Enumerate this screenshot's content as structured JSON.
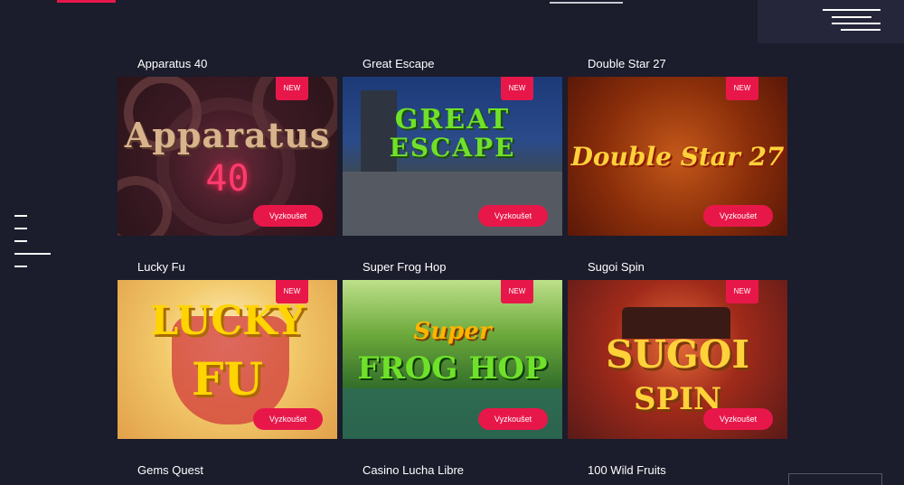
{
  "header": {
    "menu_icon": "hamburger-menu-icon",
    "side_menu_icon": "side-nav-menu-icon",
    "accent_color": "#e8174a"
  },
  "games": [
    {
      "title": "Apparatus 40",
      "badge": "NEW",
      "cta": "Vyzkoušet",
      "logo": "Apparatus",
      "sub": "40"
    },
    {
      "title": "Great Escape",
      "badge": "NEW",
      "cta": "Vyzkoušet",
      "logo": "GREAT",
      "sub": "ESCAPE"
    },
    {
      "title": "Double Star 27",
      "badge": "NEW",
      "cta": "Vyzkoušet",
      "logo": "Double Star 27",
      "sub": ""
    },
    {
      "title": "Lucky Fu",
      "badge": "NEW",
      "cta": "Vyzkoušet",
      "logo": "LUCKY",
      "sub": "FU"
    },
    {
      "title": "Super Frog Hop",
      "badge": "NEW",
      "cta": "Vyzkoušet",
      "logo": "Super",
      "sub": "FROG HOP"
    },
    {
      "title": "Sugoi Spin",
      "badge": "NEW",
      "cta": "Vyzkoušet",
      "logo": "SUGOI",
      "sub": "SPIN"
    },
    {
      "title": "Gems Quest"
    },
    {
      "title": "Casino Lucha Libre"
    },
    {
      "title": "100 Wild Fruits"
    }
  ]
}
